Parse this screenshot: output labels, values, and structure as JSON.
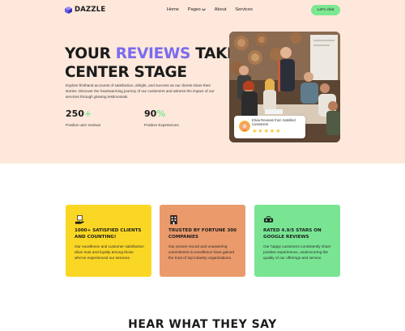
{
  "brand": {
    "name": "DAZZLE"
  },
  "nav": {
    "items": [
      "Home",
      "Pages",
      "About",
      "Services"
    ],
    "cta_label": "Let's chat"
  },
  "hero": {
    "headline_part1": "YOUR ",
    "headline_accent": "REVIEWS",
    "headline_part2": " TAKE",
    "headline_line2": "CENTER STAGE",
    "description": "Explore firsthand accounts of satisfaction, delight, and success as our clients share their stories. Discover the heartwarming journey of our customers and witness the impact of our services through glowing testimonials.",
    "stats": [
      {
        "number": "250",
        "suffix": "+",
        "label": "Positive user reviews"
      },
      {
        "number": "90",
        "suffix": "%",
        "label": "Positive Experiences"
      }
    ],
    "review_card": {
      "text": "Elivia Reviews from Satisfied Customers",
      "rating": 5
    }
  },
  "features": [
    {
      "icon": "hand-with-cube-icon",
      "title": "1000+ SATISFIED CLIENTS AND COUNTING!",
      "body": "Our excellence and customer satisfaction drive trust and loyalty among those who've experienced our services.",
      "color": "#fbd725"
    },
    {
      "icon": "building-icon",
      "title": "TRUSTED BY FORTUNE 300 COMPANIES",
      "body": "Our proven record and unwavering commitment to excellence have gained the trust of top industry organizations.",
      "color": "#ea9a6b"
    },
    {
      "icon": "vr-headset-icon",
      "title": "RATED 4.9/5 STARS ON GOOGLE REVIEWS",
      "body": "Our happy customers consistently share positive experiences, underscoring the quality of our offerings and service.",
      "color": "#79e593"
    }
  ],
  "bottom": {
    "heading": "HEAR WHAT THEY SAY"
  },
  "colors": {
    "hero_bg": "#fde8db",
    "accent": "#7a6bee",
    "cta": "#7ce891",
    "star": "#f7c531"
  }
}
